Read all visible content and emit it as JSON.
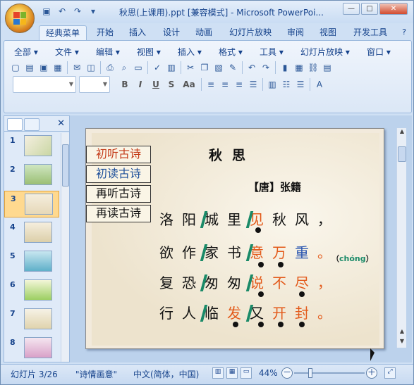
{
  "titlebar": {
    "title": "秋思(上课用).ppt [兼容模式] - Microsoft PowerPoi...",
    "qat": [
      "save-icon",
      "undo-icon",
      "redo-icon"
    ]
  },
  "ribbon_tabs": [
    "经典菜单",
    "开始",
    "插入",
    "设计",
    "动画",
    "幻灯片放映",
    "审阅",
    "视图",
    "开发工具"
  ],
  "classic_menu": [
    "全部",
    "文件",
    "编辑",
    "视图",
    "插入",
    "格式",
    "工具",
    "幻灯片放映",
    "窗口"
  ],
  "format_buttons": [
    "B",
    "I",
    "U",
    "S",
    "Aa"
  ],
  "slide_panel": {
    "thumbs": [
      "1",
      "2",
      "3",
      "4",
      "5",
      "6",
      "7",
      "8"
    ],
    "selected": "3"
  },
  "slide": {
    "nav_buttons": [
      {
        "label": "初听古诗"
      },
      {
        "label": "初读古诗"
      },
      {
        "label": "再听古诗"
      },
      {
        "label": "再读古诗"
      }
    ],
    "title": "秋思",
    "author": "【唐】张籍",
    "lines": [
      [
        "洛",
        "阳",
        "城",
        "里",
        "见",
        "秋",
        "风",
        "，"
      ],
      [
        "欲",
        "作",
        "家",
        "书",
        "意",
        "万",
        "重",
        "。"
      ],
      [
        "复",
        "恐",
        "匆",
        "匆",
        "说",
        "不",
        "尽",
        "，"
      ],
      [
        "行",
        "人",
        "临",
        "发",
        "又",
        "开",
        "封",
        "。"
      ]
    ],
    "pinyin_open": "（",
    "pinyin": "chóng",
    "pinyin_close": "）"
  },
  "status": {
    "slide_info": "幻灯片 3/26",
    "theme": "\"诗情画意\"",
    "language": "中文(简体，中国)",
    "zoom": "44%",
    "zoom_value": 44,
    "zoom_minus": "－",
    "zoom_plus": "＋"
  }
}
